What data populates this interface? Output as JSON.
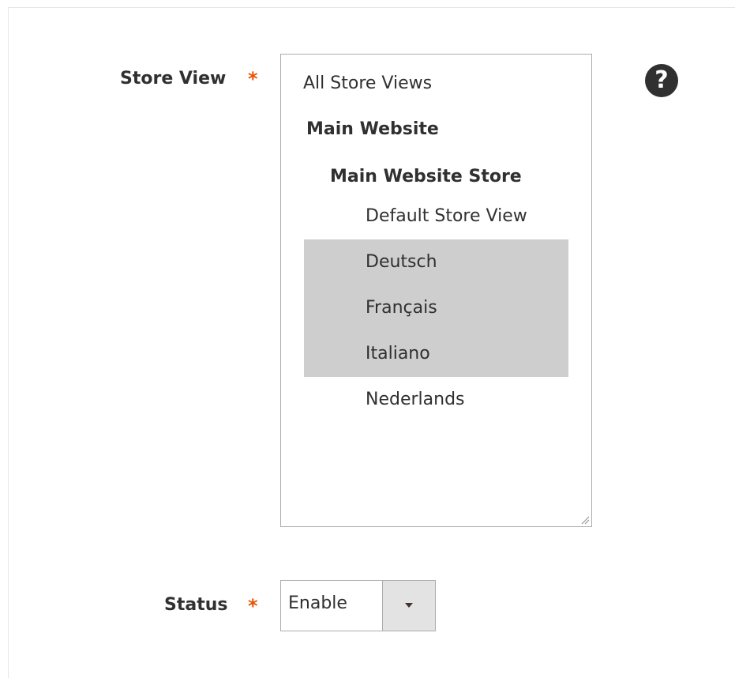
{
  "store_view": {
    "label": "Store View",
    "required_mark": "*",
    "options": [
      {
        "label": "All Store Views",
        "kind": "option",
        "selected": false
      },
      {
        "label": "Main Website",
        "kind": "group",
        "selected": false
      },
      {
        "label": "Main Website Store",
        "kind": "group",
        "selected": false
      },
      {
        "label": "Default Store View",
        "kind": "option",
        "selected": false
      },
      {
        "label": "Deutsch",
        "kind": "option",
        "selected": true
      },
      {
        "label": "Français",
        "kind": "option",
        "selected": true
      },
      {
        "label": "Italiano",
        "kind": "option",
        "selected": true
      },
      {
        "label": "Nederlands",
        "kind": "option",
        "selected": false
      }
    ],
    "help_icon": "question-icon",
    "help_glyph": "?"
  },
  "status": {
    "label": "Status",
    "required_mark": "*",
    "value": "Enable",
    "dropdown_icon": "chevron-down-icon"
  },
  "colors": {
    "required": "#eb5202",
    "selected_bg": "#cecece",
    "text": "#303030"
  }
}
